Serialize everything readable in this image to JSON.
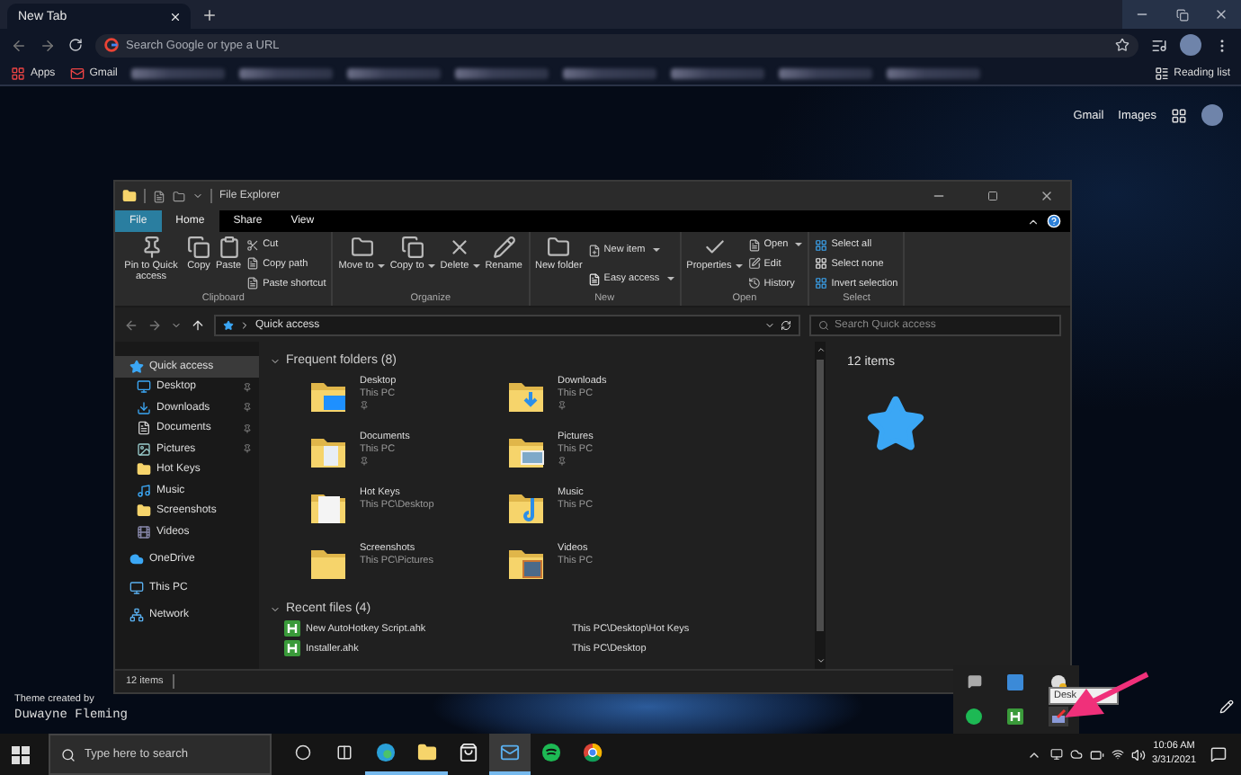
{
  "browser": {
    "tab": {
      "title": "New Tab",
      "selected": true
    },
    "omnibox": {
      "placeholder": "Search Google or type a URL"
    },
    "bookmarks": [
      {
        "kind": "apps",
        "label": "Apps"
      },
      {
        "kind": "gmail",
        "label": "Gmail"
      }
    ],
    "reading_list": "Reading list",
    "links": [
      "Gmail",
      "Images"
    ]
  },
  "explorer": {
    "title": "File Explorer",
    "ribbon_tabs": [
      {
        "label": "File",
        "kind": "file",
        "selected": false
      },
      {
        "label": "Home",
        "kind": "tab",
        "selected": true
      },
      {
        "label": "Share",
        "kind": "tab",
        "selected": false
      },
      {
        "label": "View",
        "kind": "tab",
        "selected": false
      }
    ],
    "ribbon_groups": [
      {
        "label": "Clipboard",
        "items": [
          {
            "kind": "large",
            "label": "Pin to Quick access",
            "dropdown": false
          },
          {
            "kind": "large",
            "label": "Copy",
            "dropdown": false
          },
          {
            "kind": "large",
            "label": "Paste",
            "dropdown": false
          },
          {
            "kind": "small",
            "label": "Cut",
            "dropdown": false
          },
          {
            "kind": "small",
            "label": "Copy path",
            "dropdown": false
          },
          {
            "kind": "small",
            "label": "Paste shortcut",
            "dropdown": false
          }
        ]
      },
      {
        "label": "Organize",
        "items": [
          {
            "kind": "large",
            "label": "Move to",
            "dropdown": true
          },
          {
            "kind": "large",
            "label": "Copy to",
            "dropdown": true
          },
          {
            "kind": "large",
            "label": "Delete",
            "dropdown": true
          },
          {
            "kind": "large",
            "label": "Rename",
            "dropdown": false
          }
        ]
      },
      {
        "label": "New",
        "items": [
          {
            "kind": "large",
            "label": "New folder",
            "dropdown": false
          },
          {
            "kind": "small",
            "label": "New item",
            "dropdown": true
          },
          {
            "kind": "small",
            "label": "Easy access",
            "dropdown": true
          }
        ]
      },
      {
        "label": "Open",
        "items": [
          {
            "kind": "large",
            "label": "Properties",
            "dropdown": true
          },
          {
            "kind": "small",
            "label": "Open",
            "dropdown": true
          },
          {
            "kind": "small",
            "label": "Edit",
            "dropdown": false
          },
          {
            "kind": "small",
            "label": "History",
            "dropdown": false
          }
        ]
      },
      {
        "label": "Select",
        "items": [
          {
            "kind": "small",
            "label": "Select all",
            "dropdown": false
          },
          {
            "kind": "small",
            "label": "Select none",
            "dropdown": false
          },
          {
            "kind": "small",
            "label": "Invert selection",
            "dropdown": false
          }
        ]
      }
    ],
    "address": "Quick access",
    "search": {
      "placeholder": "Search Quick access"
    },
    "nav": [
      {
        "label": "Quick access",
        "kind": "star",
        "selected": true,
        "pinned": false,
        "children": [
          {
            "label": "Desktop",
            "kind": "desktop",
            "selected": false,
            "pinned": true
          },
          {
            "label": "Downloads",
            "kind": "downloads",
            "selected": false,
            "pinned": true
          },
          {
            "label": "Documents",
            "kind": "documents",
            "selected": false,
            "pinned": true
          },
          {
            "label": "Pictures",
            "kind": "pictures",
            "selected": false,
            "pinned": true
          },
          {
            "label": "Hot Keys",
            "kind": "folder",
            "selected": false,
            "pinned": false
          },
          {
            "label": "Music",
            "kind": "music",
            "selected": false,
            "pinned": false
          },
          {
            "label": "Screenshots",
            "kind": "folder",
            "selected": false,
            "pinned": false
          },
          {
            "label": "Videos",
            "kind": "videos",
            "selected": false,
            "pinned": false
          }
        ]
      },
      {
        "label": "OneDrive",
        "kind": "cloud",
        "selected": false,
        "pinned": false
      },
      {
        "label": "This PC",
        "kind": "pc",
        "selected": false,
        "pinned": false
      },
      {
        "label": "Network",
        "kind": "network",
        "selected": false,
        "pinned": false
      }
    ],
    "frequent": {
      "title": "Frequent folders (8)",
      "expanded": true,
      "folders": [
        {
          "name": "Desktop",
          "path": "This PC",
          "kind": "desktop",
          "pinned": true
        },
        {
          "name": "Downloads",
          "path": "This PC",
          "kind": "downloads",
          "pinned": true
        },
        {
          "name": "Documents",
          "path": "This PC",
          "kind": "documents",
          "pinned": true
        },
        {
          "name": "Pictures",
          "path": "This PC",
          "kind": "pictures",
          "pinned": true
        },
        {
          "name": "Hot Keys",
          "path": "This PC\\Desktop",
          "kind": "plain",
          "pinned": false
        },
        {
          "name": "Music",
          "path": "This PC",
          "kind": "music",
          "pinned": false
        },
        {
          "name": "Screenshots",
          "path": "This PC\\Pictures",
          "kind": "empty",
          "pinned": false
        },
        {
          "name": "Videos",
          "path": "This PC",
          "kind": "videos",
          "pinned": false
        }
      ]
    },
    "recent": {
      "title": "Recent files (4)",
      "expanded": true,
      "files": [
        {
          "name": "New AutoHotkey Script.ahk",
          "path": "This PC\\Desktop\\Hot Keys"
        },
        {
          "name": "Installer.ahk",
          "path": "This PC\\Desktop"
        }
      ]
    },
    "details": "12 items",
    "status": "12 items"
  },
  "theme_credit": {
    "label": "Theme created by",
    "author": "Duwayne Fleming"
  },
  "tooltip": "Desk",
  "taskbar": {
    "search": {
      "placeholder": "Type here to search"
    },
    "apps": [
      {
        "kind": "edge",
        "running": true,
        "active": false
      },
      {
        "kind": "explorer",
        "running": true,
        "active": false
      },
      {
        "kind": "store",
        "running": false,
        "active": false
      },
      {
        "kind": "mail",
        "running": true,
        "active": true
      },
      {
        "kind": "spotify",
        "running": false,
        "active": false
      },
      {
        "kind": "chrome",
        "running": false,
        "active": false
      }
    ],
    "time": "10:06 AM",
    "date": "3/31/2021"
  }
}
